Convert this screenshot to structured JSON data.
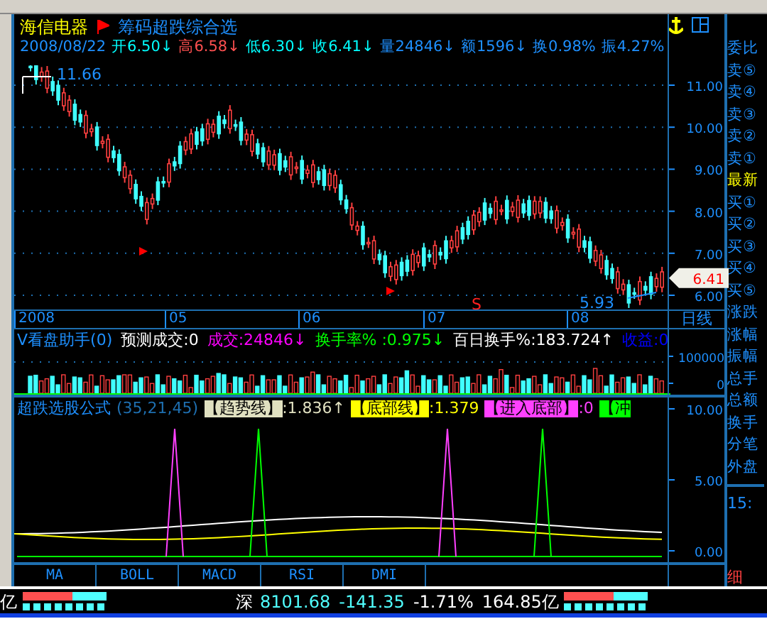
{
  "stock": {
    "name": "海信电器",
    "formula": "筹码超跌综合选"
  },
  "quote": {
    "date": "2008/08/22",
    "fields": [
      {
        "label": "开",
        "value": "6.50↓",
        "color": "#00ffff"
      },
      {
        "label": "高",
        "value": "6.58↓",
        "color": "#ff5050"
      },
      {
        "label": "低",
        "value": "6.30↓",
        "color": "#00ffff"
      },
      {
        "label": "收",
        "value": "6.41↓",
        "color": "#00ffff"
      },
      {
        "label": "量",
        "value": "24846↓",
        "color": "#1e90ff"
      },
      {
        "label": "额",
        "value": "1596↓",
        "color": "#1e90ff"
      },
      {
        "label": "换",
        "value": "0.98%",
        "color": "#1e90ff"
      },
      {
        "label": "振",
        "value": "4.27%",
        "color": "#1e90ff"
      }
    ]
  },
  "price_chart": {
    "high_label": "11.66",
    "low_label": "5.93",
    "signal": "S",
    "y_ticks": [
      "11.00",
      "10.00",
      "9.00",
      "8.00",
      "7.00",
      "6.00"
    ],
    "current": "6.41"
  },
  "date_axis": {
    "labels": [
      "2008",
      "05",
      "06",
      "07",
      "08"
    ],
    "period": "日线"
  },
  "volume": {
    "title": "V看盘助手(0)",
    "items": [
      {
        "text": "预测成交:0",
        "color": "#ffffff"
      },
      {
        "text": "成交:24846↓",
        "color": "#ff00ff"
      },
      {
        "text": "换手率% :0.975↓",
        "color": "#00ff00"
      },
      {
        "text": "百日换手%:183.724↑",
        "color": "#ffffff"
      },
      {
        "text": "收益:0",
        "color": "#0000ff"
      }
    ],
    "ticks": [
      "100000",
      "0"
    ]
  },
  "formula": {
    "title": "超跌选股公式",
    "params": "(35,21,45)",
    "items": [
      {
        "label": "【趋势线】",
        "value": ":1.836↑",
        "color": "#e0e0c0"
      },
      {
        "label": "【底部线】",
        "value": ":1.379",
        "color": "#ffff00"
      },
      {
        "label": "【进入底部】",
        "value": ":0",
        "color": "#ff40ff"
      },
      {
        "label": "【冲",
        "color": "#00ff00"
      }
    ],
    "ticks": [
      "10.00",
      "5.00",
      "0.00"
    ]
  },
  "tabs": [
    "MA",
    "BOLL",
    "MACD",
    "RSI",
    "DMI"
  ],
  "side_panel": {
    "items": [
      {
        "label": "委比",
        "color": "#1e90ff"
      },
      {
        "label": "卖⑤",
        "color": "#1e90ff"
      },
      {
        "label": "卖④",
        "color": "#1e90ff"
      },
      {
        "label": "卖③",
        "color": "#1e90ff"
      },
      {
        "label": "卖②",
        "color": "#1e90ff"
      },
      {
        "label": "卖①",
        "color": "#1e90ff"
      },
      {
        "label": "最新",
        "color": "#ffff00"
      },
      {
        "label": "买①",
        "color": "#1e90ff"
      },
      {
        "label": "买②",
        "color": "#1e90ff"
      },
      {
        "label": "买③",
        "color": "#1e90ff"
      },
      {
        "label": "买④",
        "color": "#1e90ff"
      },
      {
        "label": "买⑤",
        "color": "#1e90ff"
      },
      {
        "label": "涨跌",
        "color": "#1e90ff"
      },
      {
        "label": "涨幅",
        "color": "#1e90ff"
      },
      {
        "label": "振幅",
        "color": "#1e90ff"
      },
      {
        "label": "总手",
        "color": "#1e90ff"
      },
      {
        "label": "总额",
        "color": "#1e90ff"
      },
      {
        "label": "换手",
        "color": "#1e90ff"
      },
      {
        "label": "分笔",
        "color": "#1e90ff"
      },
      {
        "label": "外盘",
        "color": "#1e90ff"
      }
    ],
    "time": "15:",
    "detail_tab": "细"
  },
  "status_bar": {
    "left_cut": "亿",
    "index": "深",
    "value": "8101.68",
    "change": "-141.35",
    "percent": "-1.71%",
    "amount": "164.85亿"
  }
}
